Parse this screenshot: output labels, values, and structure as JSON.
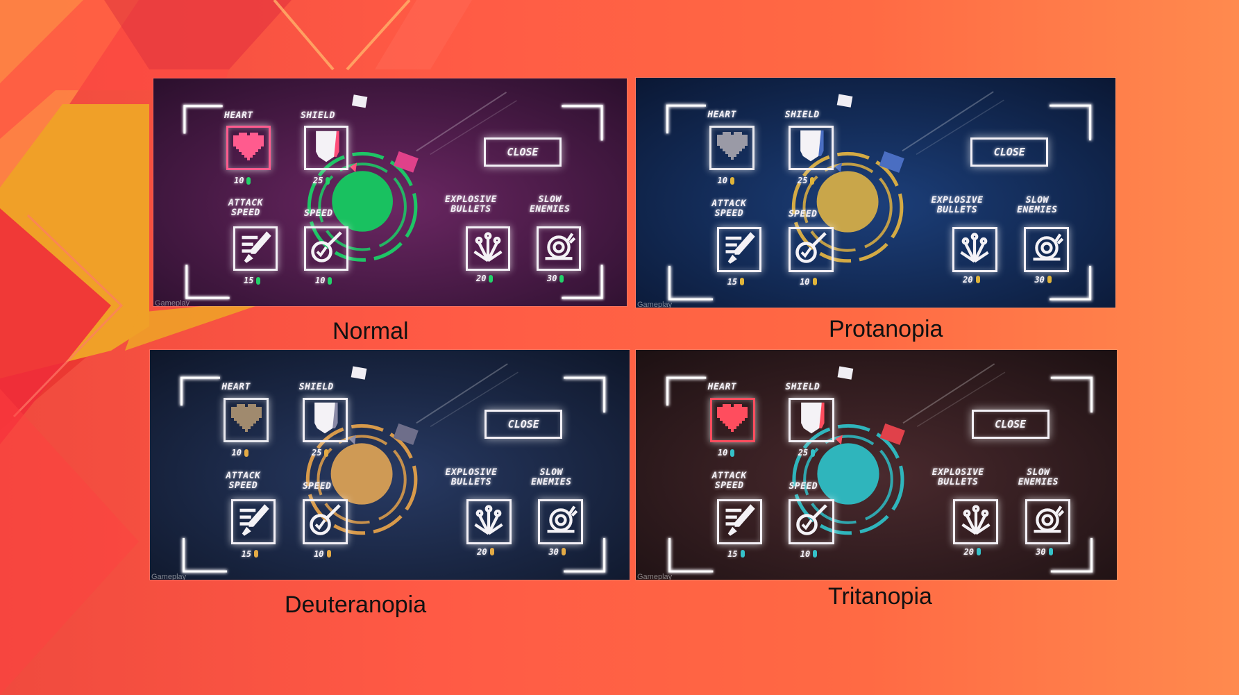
{
  "panels": [
    {
      "key": "normal",
      "caption": "Normal",
      "bg_center": "#6b2763",
      "bg_edge": "#2a0f2c",
      "heart_color": "#ff5b8e",
      "heart_border": "#ff5b8e",
      "player_color": "#19c160",
      "ring_color": "#1ec566",
      "cube_color": "#e0418a",
      "shield_accent": "#ff4d7a",
      "coin_color": "#23d26a"
    },
    {
      "key": "protanopia",
      "caption": "Protanopia",
      "bg_center": "#1c3f7a",
      "bg_edge": "#0a1733",
      "heart_color": "#9a9aa6",
      "heart_border": "#e8e8ee",
      "player_color": "#c9a64a",
      "ring_color": "#d4aa44",
      "cube_color": "#4a6ec2",
      "shield_accent": "#4a6ec2",
      "coin_color": "#e0b43a"
    },
    {
      "key": "deuteranopia",
      "caption": "Deuteranopia",
      "bg_center": "#283a63",
      "bg_edge": "#0e1629",
      "heart_color": "#a08a6e",
      "heart_border": "#e8e8ee",
      "player_color": "#cf9a55",
      "ring_color": "#d89a4a",
      "cube_color": "#6e6e8a",
      "shield_accent": "#8a8aa6",
      "coin_color": "#e3aa45"
    },
    {
      "key": "tritanopia",
      "caption": "Tritanopia",
      "bg_center": "#4a2a2e",
      "bg_edge": "#1c1012",
      "heart_color": "#ff4d5e",
      "heart_border": "#ff4d5e",
      "player_color": "#2fb5bc",
      "ring_color": "#2fb5bc",
      "cube_color": "#e0414a",
      "shield_accent": "#ff4d5e",
      "coin_color": "#35c2c9"
    }
  ],
  "shop": {
    "heart_label": "HEART",
    "shield_label": "SHIELD",
    "attack_speed_label": "ATTACK\nSPEED",
    "speed_label": "SPEED",
    "explosive_label": "EXPLOSIVE\nBULLETS",
    "slow_label": "SLOW\nENEMIES",
    "close_label": "CLOSE",
    "heart_price": "10",
    "shield_price": "25",
    "attack_speed_price": "15",
    "speed_price": "10",
    "explosive_price": "20",
    "slow_price": "30"
  },
  "watermark": "Gameplay"
}
